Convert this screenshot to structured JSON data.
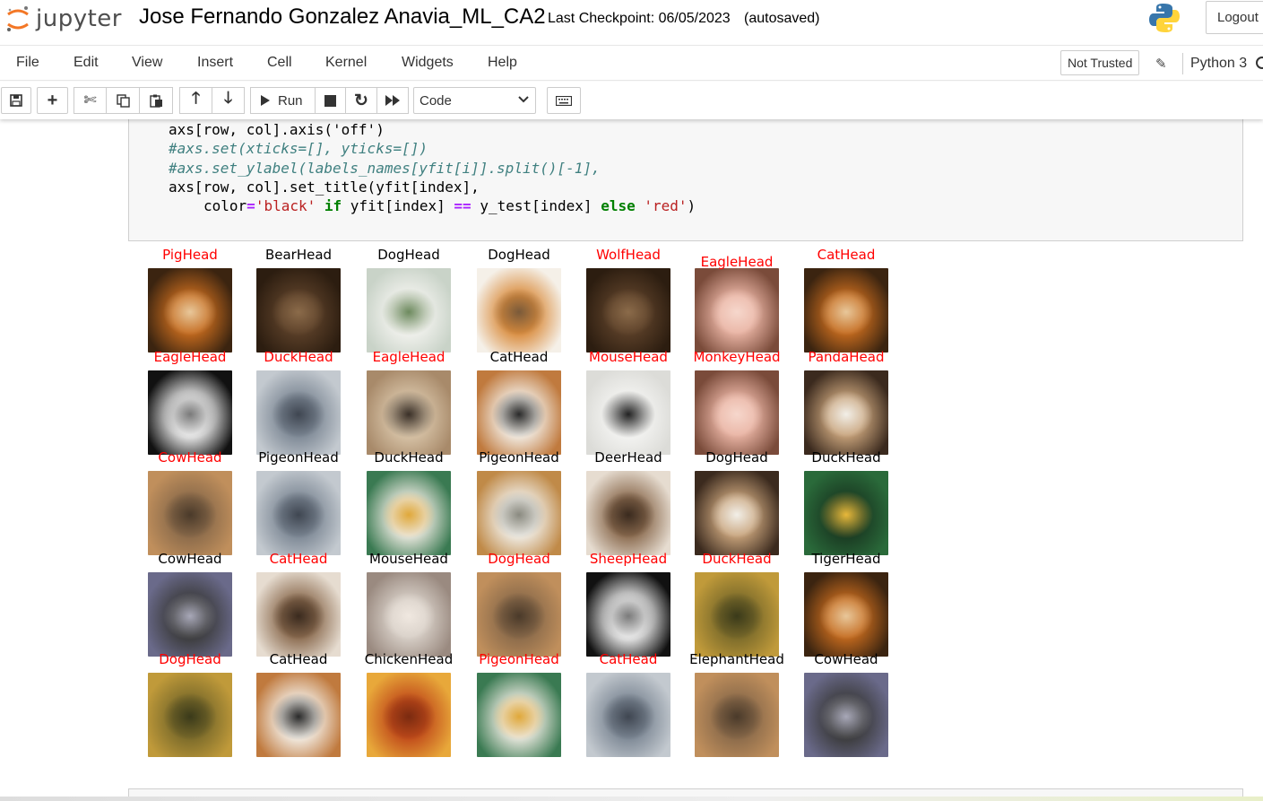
{
  "header": {
    "logo_text": "jupyter",
    "notebook_title": "Jose Fernando Gonzalez Anavia_ML_CA2",
    "checkpoint": "Last Checkpoint: 06/05/2023",
    "autosave_status": "(autosaved)",
    "logout_label": "Logout",
    "logo_icon": "jupyter-logo-icon",
    "kernel_logo_icon": "python-logo-icon"
  },
  "menubar": {
    "items": [
      "File",
      "Edit",
      "View",
      "Insert",
      "Cell",
      "Kernel",
      "Widgets",
      "Help"
    ],
    "trust_label": "Not Trusted",
    "kernel_label": "Python 3"
  },
  "toolbar": {
    "run_label": "Run",
    "cell_type": "Code",
    "buttons": [
      "save-icon",
      "plus-icon",
      "cut-icon",
      "copy-icon",
      "paste-icon",
      "arrow-up-icon",
      "arrow-down-icon",
      "run-icon",
      "stop-icon",
      "restart-icon",
      "fast-forward-icon",
      "keyboard-icon"
    ]
  },
  "code": {
    "lines": [
      "axs[row, col].axis('off')",
      "#axs.set(xticks=[], yticks=[])",
      "#axs.set_ylabel(labels_names[yfit[i]].split()[-1],",
      "axs[row, col].set_title(yfit[index],",
      "color='black' if yfit[index] == y_test[index] else 'red')"
    ]
  },
  "output": {
    "rows": [
      [
        {
          "label": "PigHead",
          "color": "red",
          "subject": "tiger"
        },
        {
          "label": "BearHead",
          "color": "black",
          "subject": "bear"
        },
        {
          "label": "DogHead",
          "color": "black",
          "subject": "white dog"
        },
        {
          "label": "DogHead",
          "color": "black",
          "subject": "corgi"
        },
        {
          "label": "WolfHead",
          "color": "red",
          "subject": "bear"
        },
        {
          "label": "EagleHead",
          "color": "red",
          "subject": "pig"
        },
        {
          "label": "CatHead",
          "color": "red",
          "subject": "tiger"
        }
      ],
      [
        {
          "label": "EagleHead",
          "color": "red",
          "subject": "panda"
        },
        {
          "label": "DuckHead",
          "color": "red",
          "subject": "pigeon"
        },
        {
          "label": "EagleHead",
          "color": "red",
          "subject": "poodle"
        },
        {
          "label": "CatHead",
          "color": "black",
          "subject": "cat"
        },
        {
          "label": "MouseHead",
          "color": "red",
          "subject": "polar bear"
        },
        {
          "label": "MonkeyHead",
          "color": "red",
          "subject": "pig"
        },
        {
          "label": "PandaHead",
          "color": "red",
          "subject": "dog"
        }
      ],
      [
        {
          "label": "CowHead",
          "color": "red",
          "subject": "elephant"
        },
        {
          "label": "PigeonHead",
          "color": "black",
          "subject": "pigeon"
        },
        {
          "label": "DuckHead",
          "color": "black",
          "subject": "duck"
        },
        {
          "label": "PigeonHead",
          "color": "black",
          "subject": "goose"
        },
        {
          "label": "DeerHead",
          "color": "black",
          "subject": "deer"
        },
        {
          "label": "DogHead",
          "color": "black",
          "subject": "dog"
        },
        {
          "label": "DuckHead",
          "color": "black",
          "subject": "mallard"
        }
      ],
      [
        {
          "label": "CowHead",
          "color": "black",
          "subject": "cow"
        },
        {
          "label": "CatHead",
          "color": "red",
          "subject": "deer"
        },
        {
          "label": "MouseHead",
          "color": "black",
          "subject": "mouse"
        },
        {
          "label": "DogHead",
          "color": "red",
          "subject": "elephant"
        },
        {
          "label": "SheepHead",
          "color": "red",
          "subject": "panda"
        },
        {
          "label": "DuckHead",
          "color": "red",
          "subject": "lion"
        },
        {
          "label": "TigerHead",
          "color": "black",
          "subject": "tiger"
        }
      ],
      [
        {
          "label": "DogHead",
          "color": "red",
          "subject": "lion"
        },
        {
          "label": "CatHead",
          "color": "black",
          "subject": "cat"
        },
        {
          "label": "ChickenHead",
          "color": "black",
          "subject": "chicken"
        },
        {
          "label": "PigeonHead",
          "color": "red",
          "subject": "duck"
        },
        {
          "label": "CatHead",
          "color": "red",
          "subject": "pigeon"
        },
        {
          "label": "ElephantHead",
          "color": "black",
          "subject": "elephant"
        },
        {
          "label": "CowHead",
          "color": "black",
          "subject": "cow"
        }
      ]
    ]
  }
}
